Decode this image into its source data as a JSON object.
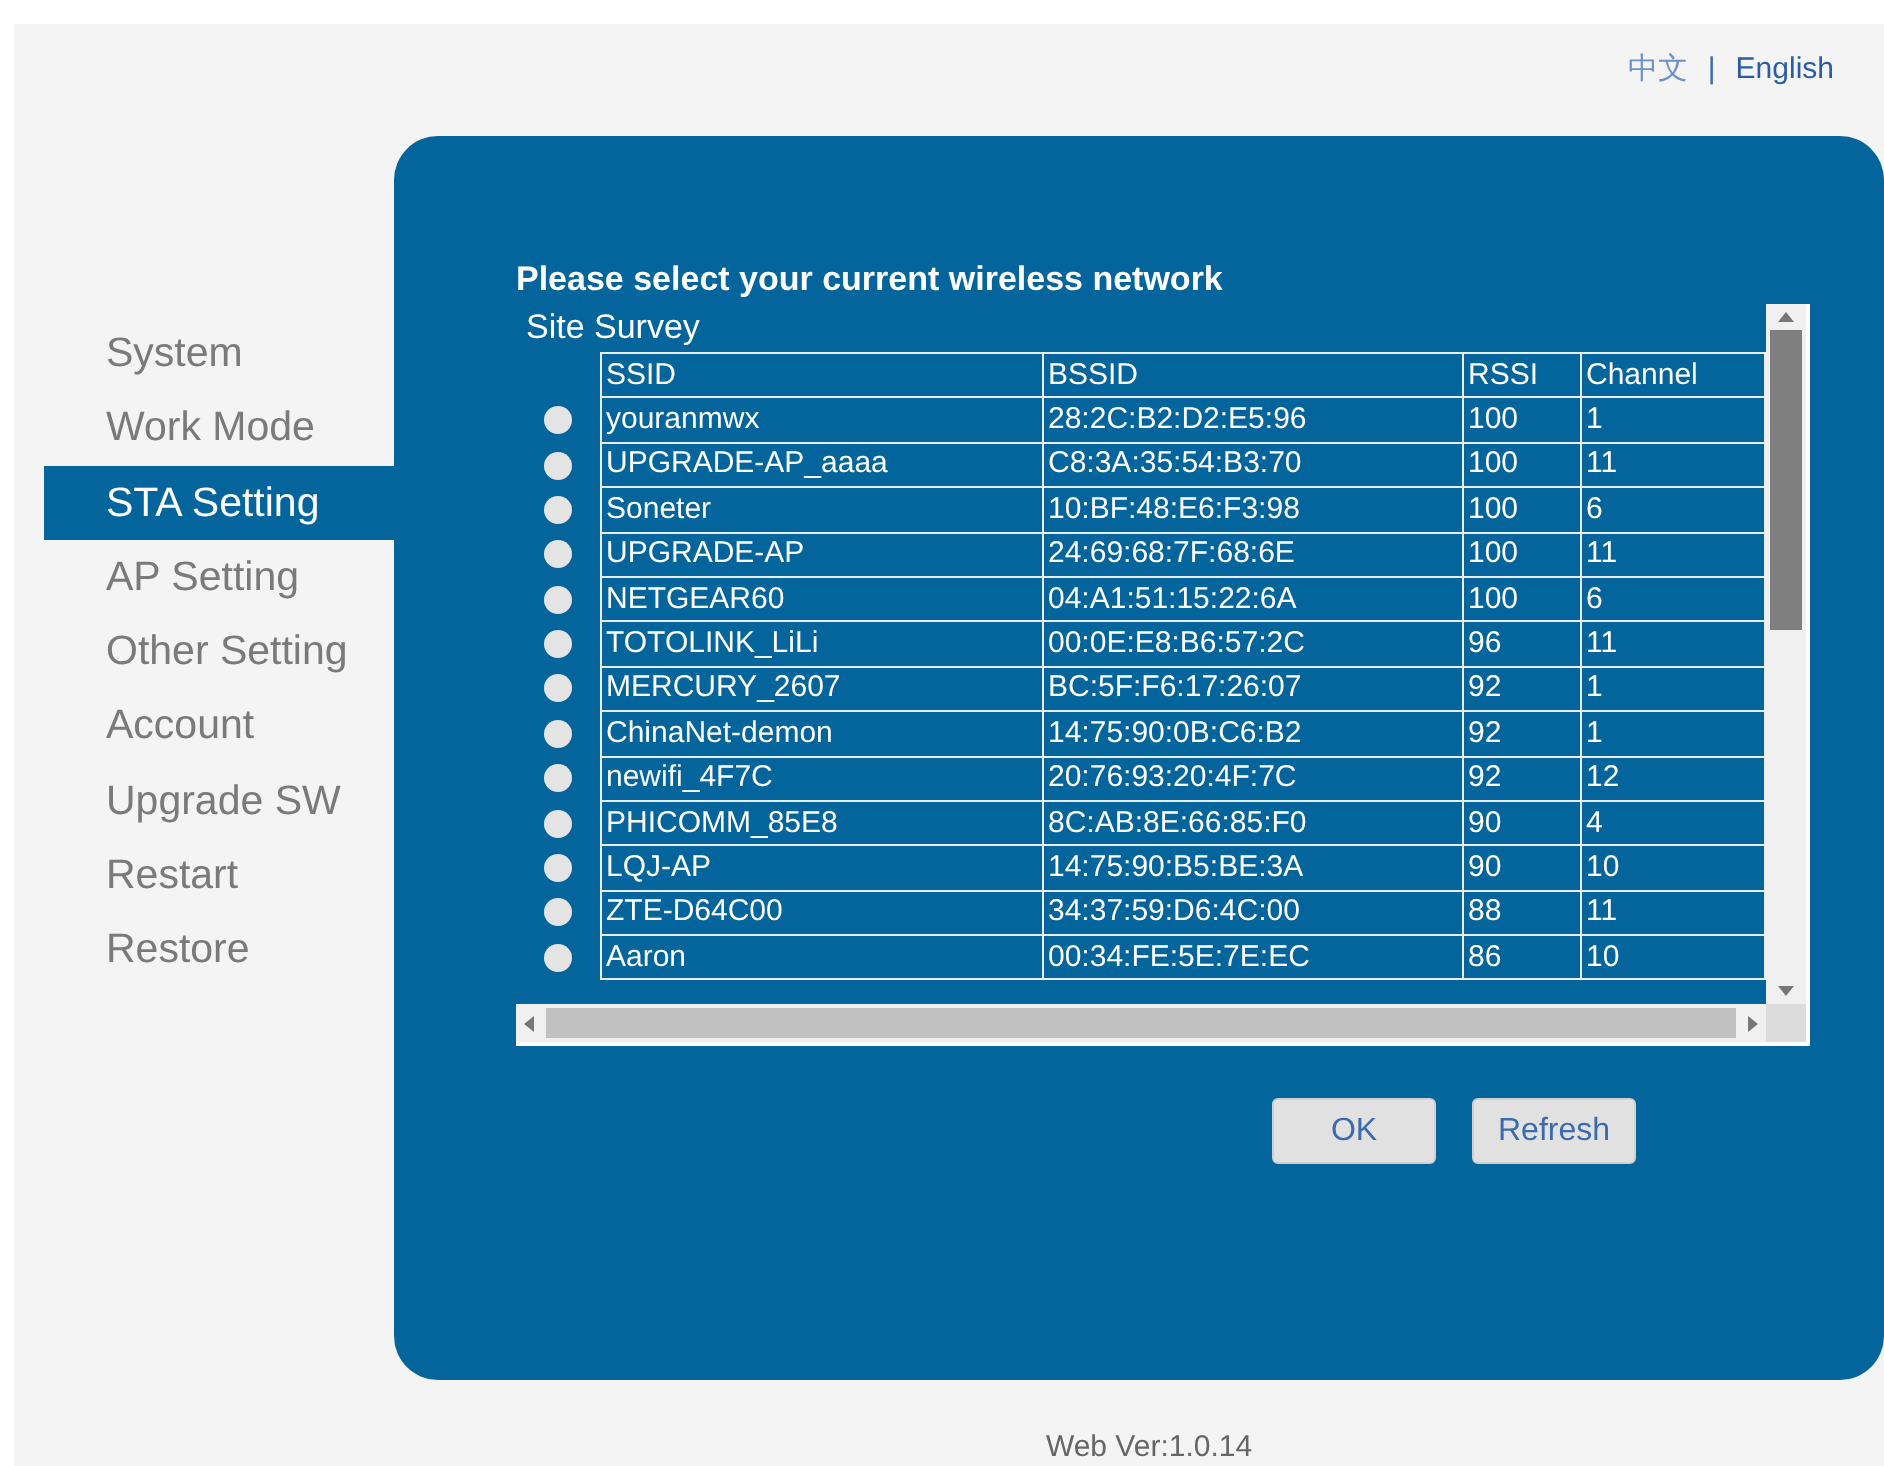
{
  "languages": [
    {
      "label": "中文",
      "selected": false
    },
    {
      "label": "English",
      "selected": true
    }
  ],
  "language_separator": "|",
  "sidebar": {
    "items": [
      {
        "label": "System",
        "selected": false
      },
      {
        "label": "Work Mode",
        "selected": false
      },
      {
        "label": "STA Setting",
        "selected": true
      },
      {
        "label": "AP Setting",
        "selected": false
      },
      {
        "label": "Other Setting",
        "selected": false
      },
      {
        "label": "Account",
        "selected": false
      },
      {
        "label": "Upgrade SW",
        "selected": false
      },
      {
        "label": "Restart",
        "selected": false
      },
      {
        "label": "Restore",
        "selected": false
      }
    ]
  },
  "heading": "Please select your current wireless network",
  "site_survey": {
    "title": "Site Survey",
    "columns": [
      "SSID",
      "BSSID",
      "RSSI",
      "Channel"
    ],
    "rows": [
      {
        "cells": [
          "youranmwx",
          "28:2C:B2:D2:E5:96",
          "100",
          "1"
        ],
        "selected": false
      },
      {
        "cells": [
          "UPGRADE-AP_aaaa",
          "C8:3A:35:54:B3:70",
          "100",
          "11"
        ],
        "selected": false
      },
      {
        "cells": [
          "Soneter",
          "10:BF:48:E6:F3:98",
          "100",
          "6"
        ],
        "selected": false
      },
      {
        "cells": [
          "UPGRADE-AP",
          "24:69:68:7F:68:6E",
          "100",
          "11"
        ],
        "selected": false
      },
      {
        "cells": [
          "NETGEAR60",
          "04:A1:51:15:22:6A",
          "100",
          "6"
        ],
        "selected": false
      },
      {
        "cells": [
          "TOTOLINK_LiLi",
          "00:0E:E8:B6:57:2C",
          "96",
          "11"
        ],
        "selected": false
      },
      {
        "cells": [
          "MERCURY_2607",
          "BC:5F:F6:17:26:07",
          "92",
          "1"
        ],
        "selected": false
      },
      {
        "cells": [
          "ChinaNet-demon",
          "14:75:90:0B:C6:B2",
          "92",
          "1"
        ],
        "selected": false
      },
      {
        "cells": [
          "newifi_4F7C",
          "20:76:93:20:4F:7C",
          "92",
          "12"
        ],
        "selected": false
      },
      {
        "cells": [
          "PHICOMM_85E8",
          "8C:AB:8E:66:85:F0",
          "90",
          "4"
        ],
        "selected": false
      },
      {
        "cells": [
          "LQJ-AP",
          "14:75:90:B5:BE:3A",
          "90",
          "10"
        ],
        "selected": false
      },
      {
        "cells": [
          "ZTE-D64C00",
          "34:37:59:D6:4C:00",
          "88",
          "11"
        ],
        "selected": false
      },
      {
        "cells": [
          "Aaron",
          "00:34:FE:5E:7E:EC",
          "86",
          "10"
        ],
        "selected": false
      }
    ]
  },
  "buttons": [
    "OK",
    "Refresh"
  ],
  "footer": "Web Ver:1.0.14"
}
